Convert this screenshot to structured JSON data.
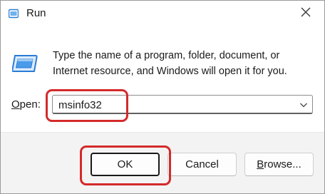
{
  "window": {
    "title": "Run",
    "title_icon": "run-icon",
    "close_icon": "close-icon"
  },
  "content": {
    "icon": "run-program-icon",
    "description_line1": "Type the name of a program, folder, document, or",
    "description_line2": "Internet resource, and Windows will open it for you."
  },
  "open_field": {
    "label_accel": "O",
    "label_rest": "pen:",
    "value": "msinfo32",
    "dropdown_icon": "chevron-down-icon"
  },
  "buttons": {
    "ok": "OK",
    "cancel": "Cancel",
    "browse_accel": "B",
    "browse_rest": "rowse..."
  },
  "colors": {
    "highlight": "#d42a2a",
    "icon_blue": "#2b7bd6",
    "footer_bg": "#f3f3f3"
  }
}
